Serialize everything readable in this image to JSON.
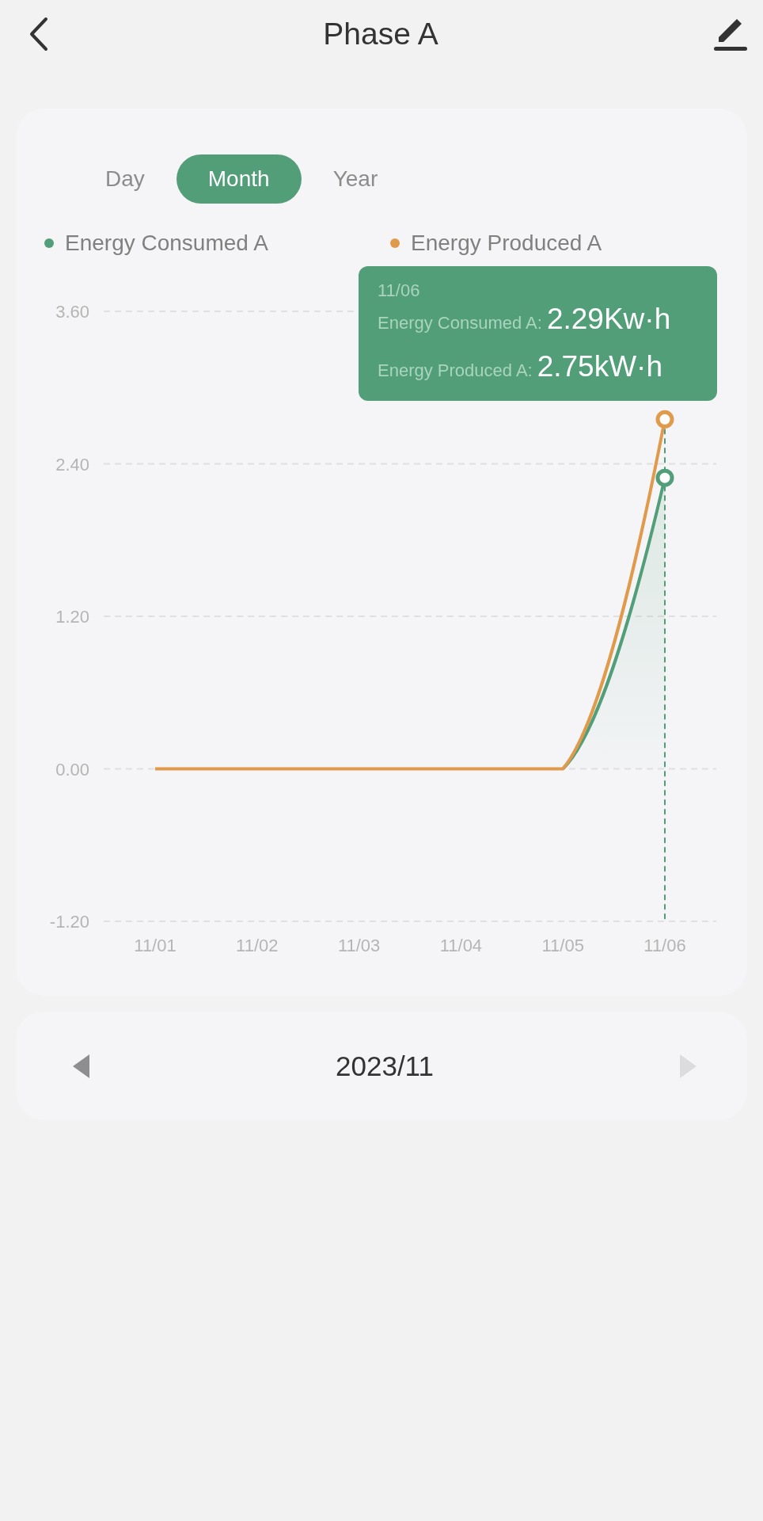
{
  "header": {
    "title": "Phase A"
  },
  "tabs": [
    {
      "label": "Day",
      "selected": false
    },
    {
      "label": "Month",
      "selected": true
    },
    {
      "label": "Year",
      "selected": false
    }
  ],
  "chart": {
    "chart_data": {
      "type": "line",
      "categories": [
        "11/01",
        "11/02",
        "11/03",
        "11/04",
        "11/05",
        "11/06"
      ],
      "ylim": [
        -1.2,
        3.6
      ],
      "yticks": [
        {
          "value": -1.2,
          "label": "-1.20"
        },
        {
          "value": 0,
          "label": "0.00"
        },
        {
          "value": 1.2,
          "label": "1.20"
        },
        {
          "value": 2.4,
          "label": "2.40"
        },
        {
          "value": 3.6,
          "label": "3.60"
        }
      ],
      "grid": true,
      "ref_lines": [
        {
          "axis": "x",
          "value": "11/06",
          "color": "#529e78"
        }
      ],
      "series": [
        {
          "name": "Energy Consumed A",
          "color": "#529e78",
          "values": [
            null,
            null,
            null,
            null,
            0,
            2.29
          ]
        },
        {
          "name": "Energy Produced A",
          "color": "#e09a4c",
          "values": [
            0,
            0,
            0,
            0,
            0,
            2.75
          ]
        }
      ]
    },
    "tooltip": {
      "title": "11/06",
      "rows": [
        {
          "label": "Energy Consumed A:",
          "value": "2.29Kw·h"
        },
        {
          "label": "Energy Produced A:",
          "value": "2.75kW·h"
        }
      ]
    }
  },
  "period": {
    "label": "2023/11",
    "prev": {
      "disabled": false
    },
    "next": {
      "disabled": true
    }
  }
}
